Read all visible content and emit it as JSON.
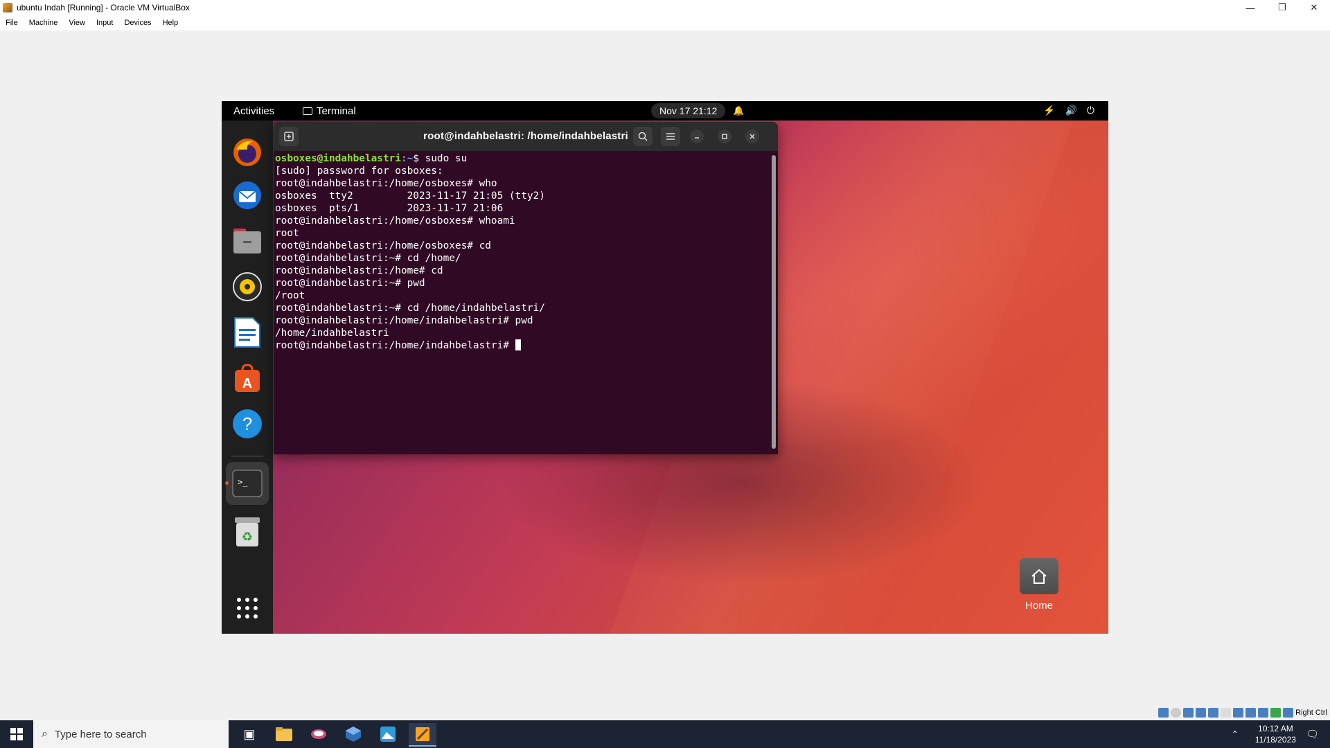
{
  "host": {
    "window_title": "ubuntu Indah [Running] - Oracle VM VirtualBox",
    "controls": {
      "minimize": "—",
      "restore": "❐",
      "close": "✕"
    },
    "menu": [
      "File",
      "Machine",
      "View",
      "Input",
      "Devices",
      "Help"
    ],
    "status_right_ctrl": "Right Ctrl"
  },
  "vm": {
    "topbar": {
      "activities": "Activities",
      "app_name": "Terminal",
      "clock": "Nov 17  21:12",
      "bell_icon": "🔔",
      "tray": {
        "network": "⚡",
        "volume": "🔊",
        "power": "⏻"
      }
    },
    "dock": [
      {
        "name": "firefox",
        "icon": "firefox-icon"
      },
      {
        "name": "thunderbird",
        "icon": "thunderbird-icon"
      },
      {
        "name": "files",
        "icon": "files-icon"
      },
      {
        "name": "rhythmbox",
        "icon": "rhythmbox-icon"
      },
      {
        "name": "libreoffice-writer",
        "icon": "writer-icon"
      },
      {
        "name": "app-center",
        "icon": "app-center-icon"
      },
      {
        "name": "help",
        "icon": "help-icon",
        "glyph": "?"
      },
      {
        "name": "terminal",
        "icon": "terminal-icon",
        "glyph": ">_"
      },
      {
        "name": "trash",
        "icon": "trash-icon",
        "glyph": "♻"
      }
    ],
    "show_apps_glyph": "⋮⋮⋮",
    "terminal": {
      "title": "root@indahbelastri: /home/indahbelastri",
      "lines": [
        {
          "user": "osboxes@indahbelastri",
          "path": ":~",
          "rest": "$ sudo su"
        },
        {
          "text": "[sudo] password for osboxes:"
        },
        {
          "text": "root@indahbelastri:/home/osboxes# who"
        },
        {
          "text": "osboxes  tty2         2023-11-17 21:05 (tty2)"
        },
        {
          "text": "osboxes  pts/1        2023-11-17 21:06"
        },
        {
          "text": "root@indahbelastri:/home/osboxes# whoami"
        },
        {
          "text": "root"
        },
        {
          "text": "root@indahbelastri:/home/osboxes# cd"
        },
        {
          "text": "root@indahbelastri:~# cd /home/"
        },
        {
          "text": "root@indahbelastri:/home# cd"
        },
        {
          "text": "root@indahbelastri:~# pwd"
        },
        {
          "text": "/root"
        },
        {
          "text": "root@indahbelastri:~# cd /home/indahbelastri/"
        },
        {
          "text": "root@indahbelastri:/home/indahbelastri# pwd"
        },
        {
          "text": "/home/indahbelastri"
        },
        {
          "text": "root@indahbelastri:/home/indahbelastri# "
        }
      ]
    },
    "desktop_home_label": "Home"
  },
  "taskbar": {
    "search_placeholder": "Type here to search",
    "time": "10:12 AM",
    "date": "11/18/2023"
  }
}
